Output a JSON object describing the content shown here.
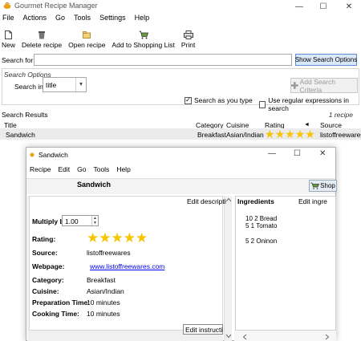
{
  "window": {
    "title": "Gourmet Recipe Manager"
  },
  "window_controls": {
    "minimize": "—",
    "maximize": "☐",
    "close": "✕"
  },
  "menu": [
    "File",
    "Actions",
    "Go",
    "Tools",
    "Settings",
    "Help"
  ],
  "toolbar": {
    "new_label": "New",
    "delete_label": "Delete recipe",
    "open_label": "Open recipe",
    "shopping_label": "Add to Shopping List",
    "print_label": "Print"
  },
  "search": {
    "label": "Search for:",
    "value": "",
    "show_options_label": "Show Search Options"
  },
  "search_options": {
    "title": "Search Options",
    "search_in_label": "Search in",
    "search_in_value": "title",
    "add_criteria_label": "Add Search Criteria",
    "as_you_type_label": "Search as you type",
    "as_you_type_checked": "✓",
    "regex_label": "Use regular expressions in search"
  },
  "results": {
    "header": "Search Results",
    "count": "1 recipe",
    "columns": {
      "title": "Title",
      "category": "Category",
      "cuisine": "Cuisine",
      "rating": "Rating",
      "source": "Source"
    },
    "source_sort_indicator": "◄",
    "rows": [
      {
        "title": "Sandwich",
        "category": "Breakfast",
        "cuisine": "Asian/Indian",
        "rating": 5,
        "source": "listoffreewares"
      }
    ]
  },
  "recipe_window": {
    "title": "Sandwich",
    "menu": [
      "Recipe",
      "Edit",
      "Go",
      "Tools",
      "Help"
    ],
    "heading": "Sandwich",
    "shop_label": "Shop",
    "edit_description_label": "Edit descripti",
    "edit_instructions_label": "Edit instructio",
    "multiply_label": "Multiply by:",
    "multiply_value": "1.00",
    "rating_label": "Rating:",
    "rating_value": 5,
    "source_label": "Source:",
    "source_value": "listoffreewares",
    "webpage_label": "Webpage:",
    "webpage_value": "www.listoffreewares.com",
    "category_label": "Category:",
    "category_value": "Breakfast",
    "cuisine_label": "Cuisine:",
    "cuisine_value": "Asian/Indian",
    "prep_label": "Preparation Time:",
    "prep_value": "10 minutes",
    "cook_label": "Cooking Time:",
    "cook_value": "10 minutes",
    "ingredients_label": "Ingredients",
    "edit_ingredients_label": "Edit ingre",
    "ingredients": [
      "10 2 Bread",
      "5 1 Tomato",
      "5 2 Oninon"
    ]
  },
  "colors": {
    "accent": "#5a8fd6",
    "link": "#0000ee",
    "star": "#f7c400",
    "selected_row": "#ebebeb"
  }
}
